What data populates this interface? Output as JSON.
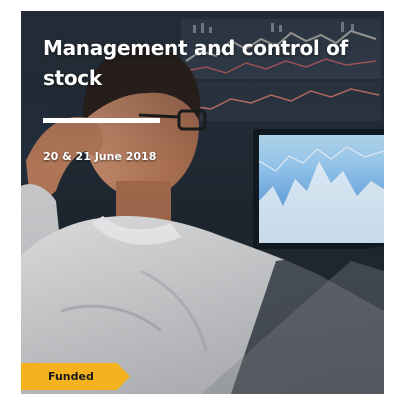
{
  "card": {
    "title": "Management and control of stock",
    "date": "20 & 21 June 2018",
    "tag": {
      "label": "Funded",
      "color": "#f4b21f"
    },
    "accent_underline_color": "#ffffff"
  }
}
